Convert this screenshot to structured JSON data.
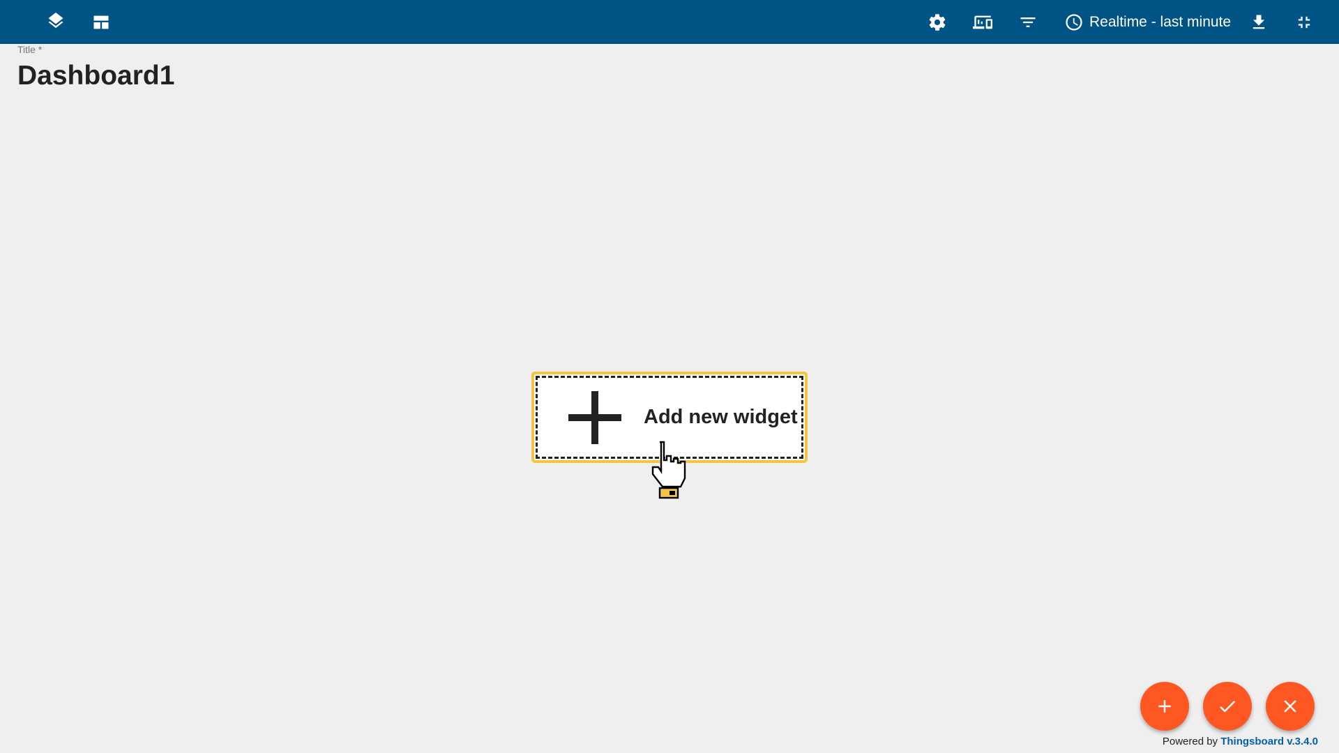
{
  "toolbar": {
    "background_color": "#005485",
    "left_icons": [
      "layers-icon",
      "layout-icon"
    ],
    "right_icons": [
      "gear-icon",
      "devices-icon",
      "filter-icon"
    ],
    "timewindow_label": "Realtime - last minute",
    "timewindow_icon": "clock-icon",
    "download_icon": "download-icon",
    "exit_fullscreen_icon": "exit-fullscreen-icon"
  },
  "title": {
    "label": "Title *",
    "value": "Dashboard1"
  },
  "add_widget": {
    "label": "Add new widget",
    "icon": "plus-icon",
    "highlight_color": "#f6c342"
  },
  "fabs": {
    "color": "#ff5722",
    "items": [
      {
        "icon": "plus-icon"
      },
      {
        "icon": "check-icon"
      },
      {
        "icon": "close-icon"
      }
    ]
  },
  "footer": {
    "prefix": "Powered by",
    "link_text": "Thingsboard v.3.4.0",
    "link_color": "#0561a6"
  }
}
